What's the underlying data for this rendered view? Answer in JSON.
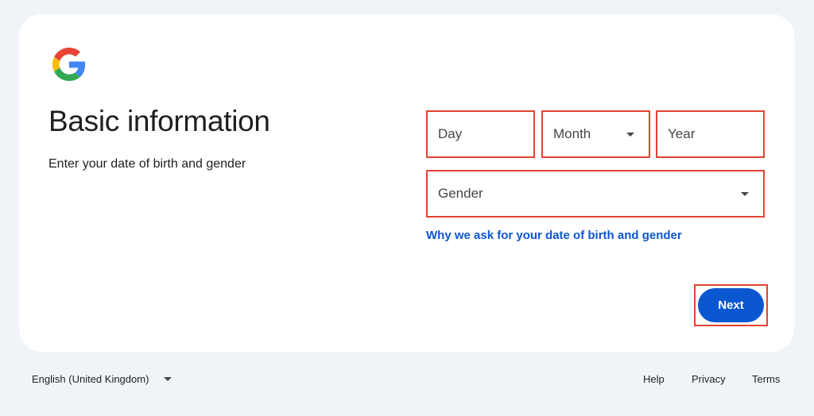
{
  "header": {
    "logo_icon": "google-g-logo-icon",
    "title": "Basic information",
    "subtitle": "Enter your date of birth and gender"
  },
  "form": {
    "day_placeholder": "Day",
    "month_placeholder": "Month",
    "year_placeholder": "Year",
    "gender_placeholder": "Gender",
    "why_link": "Why we ask for your date of birth and gender",
    "next_label": "Next"
  },
  "footer": {
    "language": "English (United Kingdom)",
    "help": "Help",
    "privacy": "Privacy",
    "terms": "Terms"
  },
  "colors": {
    "background": "#f0f4f9",
    "card": "#ffffff",
    "accent_blue": "#0b57d0",
    "highlight_red": "#e0442e"
  }
}
